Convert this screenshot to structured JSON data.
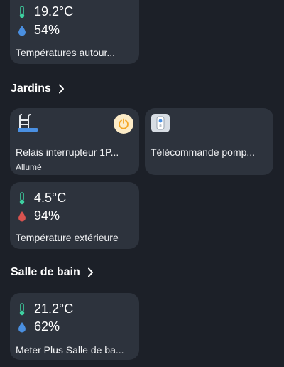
{
  "cards": {
    "temps_autour": {
      "temperature": "19.2°C",
      "humidity": "54%",
      "name": "Températures autour..."
    },
    "relais": {
      "name": "Relais interrupteur 1P...",
      "status": "Allumé"
    },
    "telecommande": {
      "name": "Télécommande pomp..."
    },
    "exterieur": {
      "temperature": "4.5°C",
      "humidity": "94%",
      "name": "Température extérieure"
    },
    "salle_de_bain": {
      "temperature": "21.2°C",
      "humidity": "62%",
      "name": "Meter Plus Salle de ba..."
    }
  },
  "sections": {
    "jardins": "Jardins",
    "salle_de_bain": "Salle de bain"
  },
  "colors": {
    "thermometer": "#3ecfa0",
    "droplet_blue": "#4a8fe0",
    "droplet_red": "#d9534f",
    "power_accent": "#f5a623"
  }
}
